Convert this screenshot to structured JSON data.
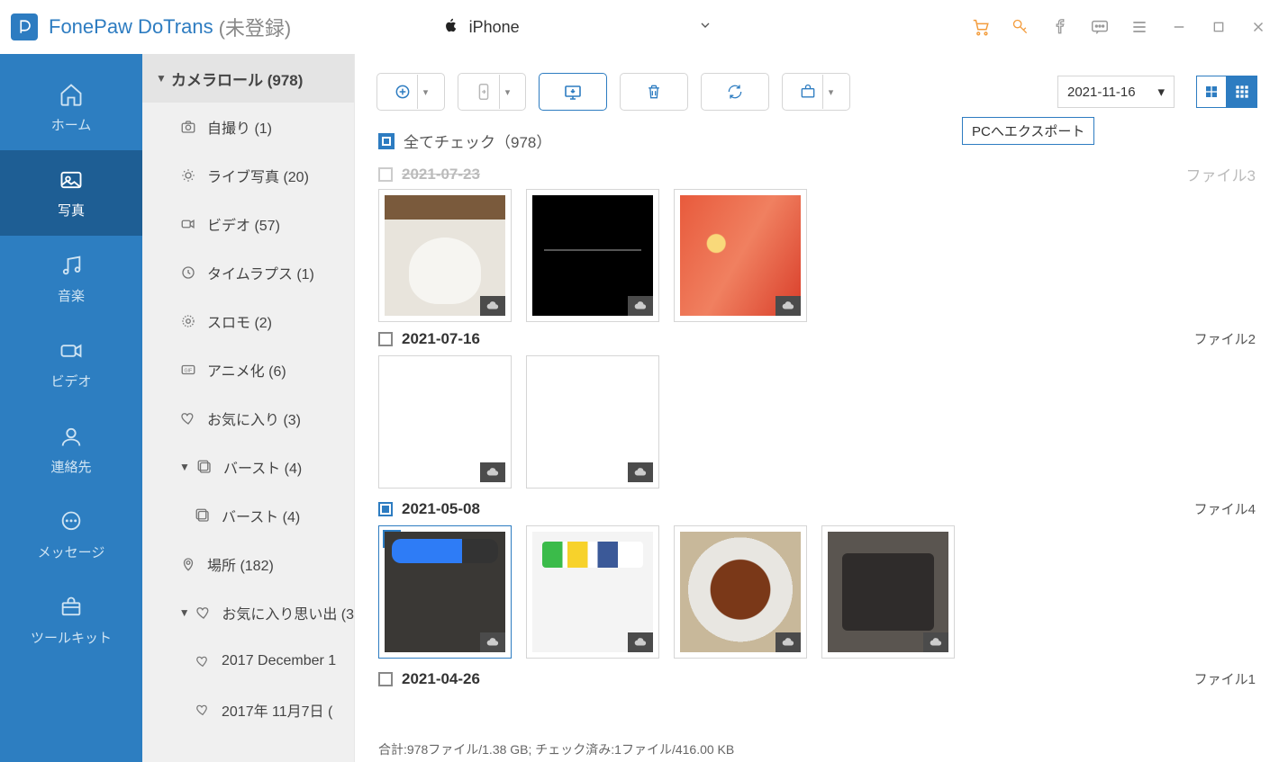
{
  "title": {
    "app": "FonePaw DoTrans",
    "reg": "(未登録)"
  },
  "device": {
    "name": "iPhone"
  },
  "nav": {
    "home": "ホーム",
    "photos": "写真",
    "music": "音楽",
    "videos": "ビデオ",
    "contacts": "連絡先",
    "messages": "メッセージ",
    "toolkit": "ツールキット"
  },
  "sidebar": {
    "head": "カメラロール (978)",
    "items": [
      {
        "icon": "camera",
        "label": "自撮り (1)"
      },
      {
        "icon": "sun",
        "label": "ライブ写真 (20)"
      },
      {
        "icon": "video",
        "label": "ビデオ (57)"
      },
      {
        "icon": "clock",
        "label": "タイムラプス (1)"
      },
      {
        "icon": "aperture",
        "label": "スロモ (2)"
      },
      {
        "icon": "gif",
        "label": "アニメ化 (6)"
      },
      {
        "icon": "heart",
        "label": "お気に入り (3)"
      }
    ],
    "burst_head": "バースト (4)",
    "burst_sub": "バースト (4)",
    "places": "場所 (182)",
    "fav_mem_head": "お気に入り思い出 (3",
    "fav_mem_items": [
      "2017 December 1",
      "2017年 11月7日 ("
    ]
  },
  "toolbar": {
    "date": "2021-11-16",
    "tooltip": "PCへエクスポート"
  },
  "checkall": "全てチェック（978）",
  "groups": {
    "g0": {
      "date": "2021-07-23",
      "files": "ファイル3"
    },
    "g1": {
      "date": "2021-07-16",
      "files": "ファイル2"
    },
    "g2": {
      "date": "2021-05-08",
      "files": "ファイル4"
    },
    "g3": {
      "date": "2021-04-26",
      "files": "ファイル1"
    }
  },
  "status": "合計:978ファイル/1.38 GB; チェック済み:1ファイル/416.00 KB"
}
